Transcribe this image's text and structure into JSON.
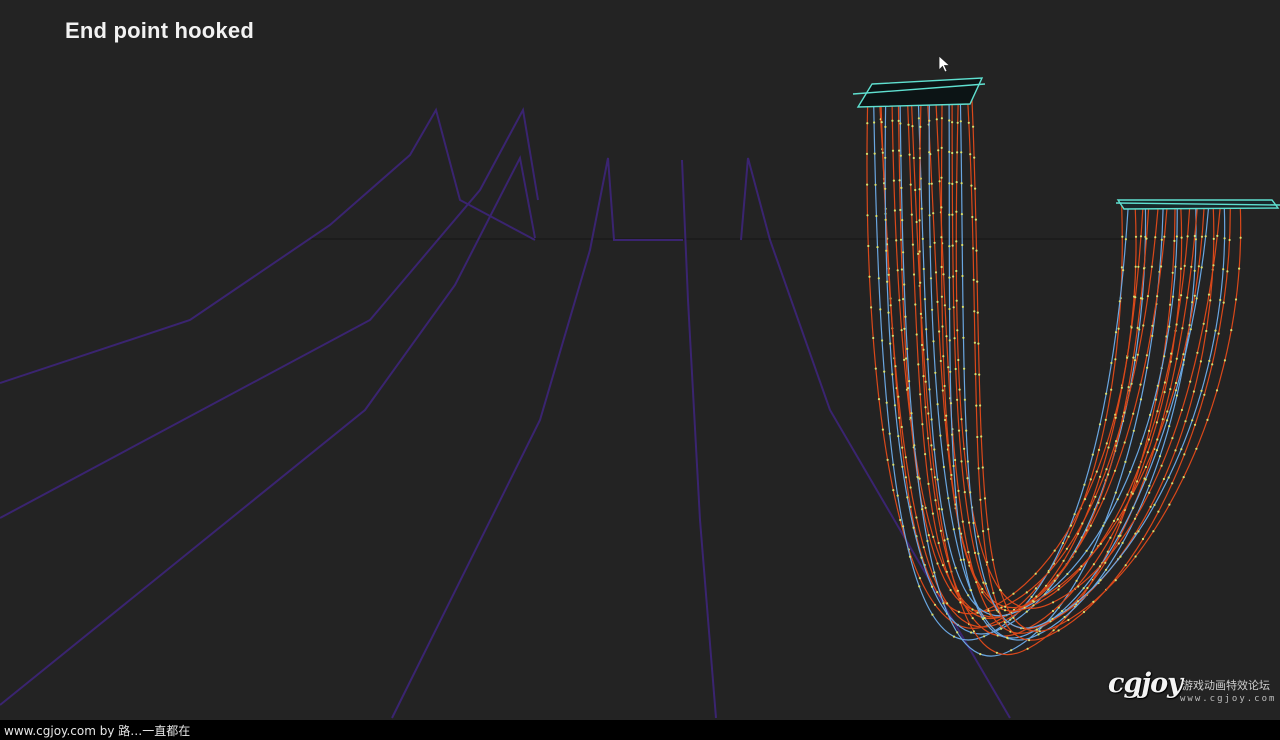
{
  "caption": "End point hooked",
  "footer": {
    "text": "www.cgjoy.com by 路…一直都在"
  },
  "watermark": {
    "logo": "cgjoy",
    "tagline": "游戏动画特效论坛",
    "url": "www.cgjoy.com"
  },
  "colors": {
    "background": "#232323",
    "guide_lines": "#3a2470",
    "strand_orange": "#d9481a",
    "strand_blue": "#6aa6e0",
    "anchor_cyan": "#5fe0d0",
    "vertex_dots": "#d8e070"
  },
  "icons": {
    "cursor": "mouse-pointer-icon"
  }
}
